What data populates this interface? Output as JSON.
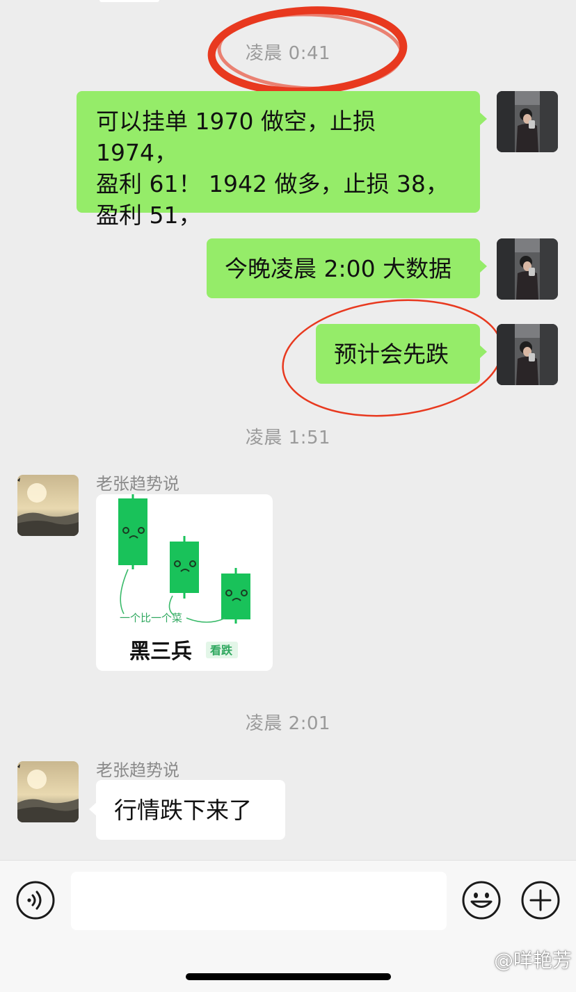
{
  "chat": {
    "timestamps": [
      "凌晨 0:41",
      "凌晨 1:51",
      "凌晨 2:01"
    ],
    "messages": [
      {
        "from": "me",
        "lines": [
          "可以挂单 1970 做空，止损 1974，",
          "盈利 61！  1942 做多，止损 38，",
          "盈利 51，"
        ]
      },
      {
        "from": "me",
        "text": "今晚凌晨 2:00 大数据"
      },
      {
        "from": "me",
        "text": "预计会先跌"
      },
      {
        "from": "other",
        "sender": "老张趋势说",
        "type": "sticker",
        "sticker": {
          "caption": "一个比一个菜",
          "title": "黑三兵",
          "tag": "看跌"
        }
      },
      {
        "from": "other",
        "sender": "老张趋势说",
        "text": "行情跌下来了"
      }
    ]
  },
  "input_bar": {
    "voice_icon": "voice-icon",
    "emoji_icon": "emoji-icon",
    "plus_icon": "plus-icon",
    "input_value": ""
  },
  "watermark": "@咩艳芳",
  "colors": {
    "my_bubble": "#95ec69",
    "their_bubble": "#ffffff",
    "background": "#ededed",
    "annotation_red": "#e8391f",
    "candle_green": "#19c25a"
  }
}
